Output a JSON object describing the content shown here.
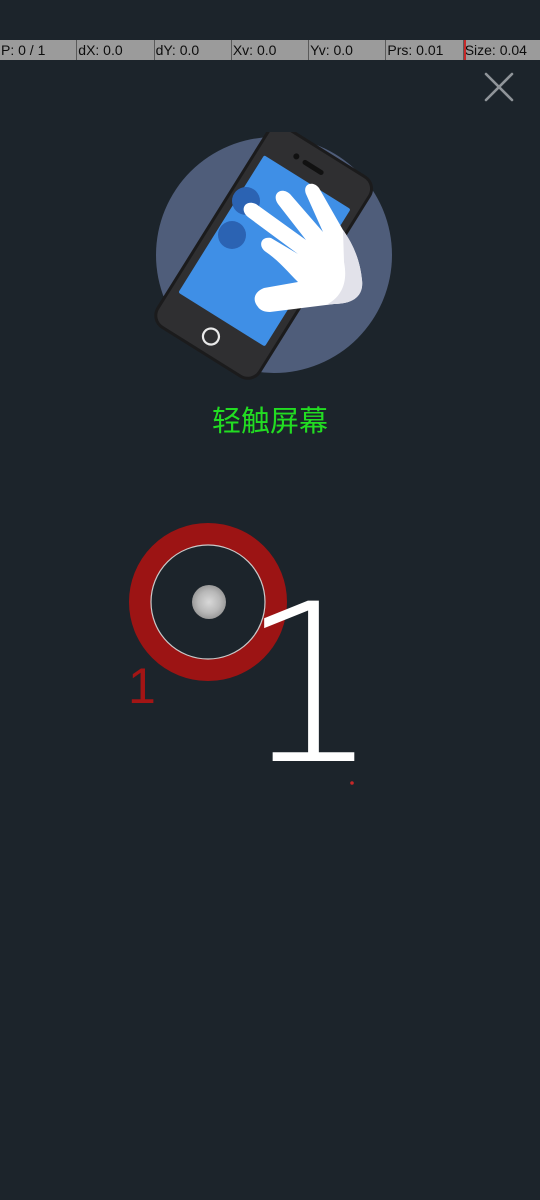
{
  "debug_bar": {
    "pointers": "P: 0 / 1",
    "dx": "dX: 0.0",
    "dy": "dY: 0.0",
    "xv": "Xv: 0.0",
    "yv": "Yv: 0.0",
    "prs": "Prs: 0.01",
    "size": "Size: 0.04"
  },
  "close_icon": "close-icon",
  "illustration_icon": "phone-hand-tap-icon",
  "hint": "轻触屏幕",
  "touch": {
    "count": "1",
    "pointer_id": "1"
  },
  "colors": {
    "background": "#1c242b",
    "debug_bar": "#9b9b9b",
    "hint": "#22dd22",
    "touch_ring": "#9c1414",
    "illustration_circle": "#4f5d7a",
    "phone_screen": "#3f8fe6"
  }
}
